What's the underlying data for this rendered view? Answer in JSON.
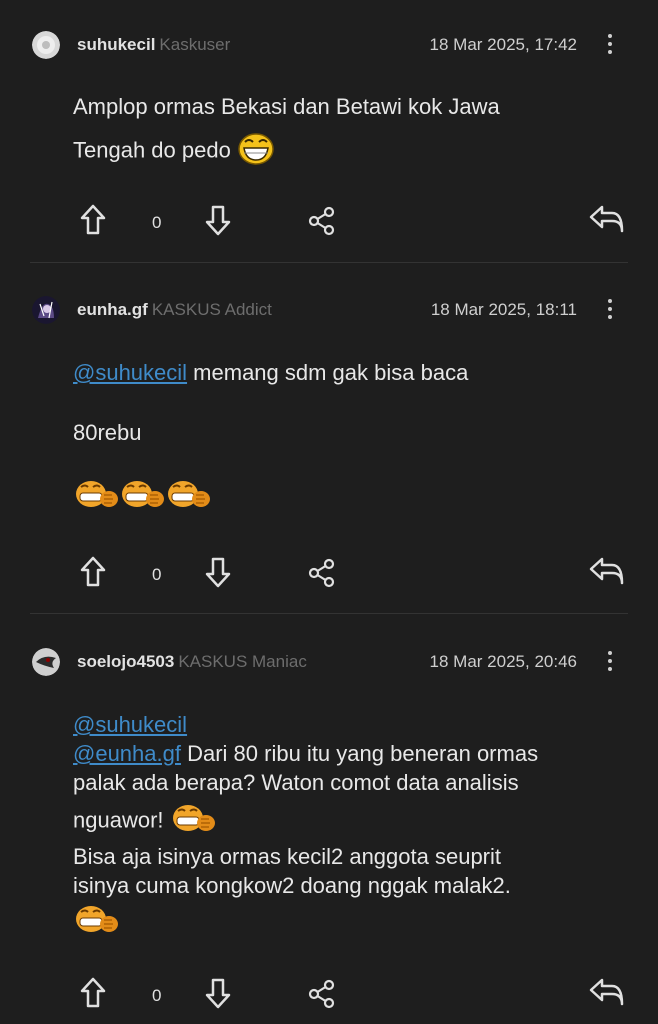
{
  "posts": [
    {
      "username": "suhukecil",
      "rank": "Kaskuser",
      "time": "18 Mar 2025, 17:42",
      "line1": "Amplop ormas Bekasi dan Betawi kok Jawa",
      "line2": "Tengah do pedo",
      "votes": "0"
    },
    {
      "username": "eunha.gf",
      "rank": "KASKUS Addict",
      "time": "18 Mar 2025, 18:11",
      "mention": "@suhukecil",
      "line1_rest": " memang sdm gak bisa baca",
      "line2": "80rebu",
      "votes": "0"
    },
    {
      "username": "soelojo4503",
      "rank": "KASKUS Maniac",
      "time": "18 Mar 2025, 20:46",
      "mention1": "@suhukecil",
      "mention2": "@eunha.gf",
      "line2_rest": " Dari 80 ribu itu yang beneran ormas",
      "line3": "palak ada berapa? Waton comot data analisis",
      "line4": "nguawor!",
      "line5": "Bisa aja isinya ormas kecil2 anggota seuprit",
      "line6": "isinya cuma kongkow2 doang nggak malak2.",
      "votes": "0"
    }
  ],
  "colors": {
    "background": "#1e1e1e",
    "mention": "#3f8bc9",
    "rank": "#6d6d6d",
    "emoji_orange": "#f0a020"
  }
}
